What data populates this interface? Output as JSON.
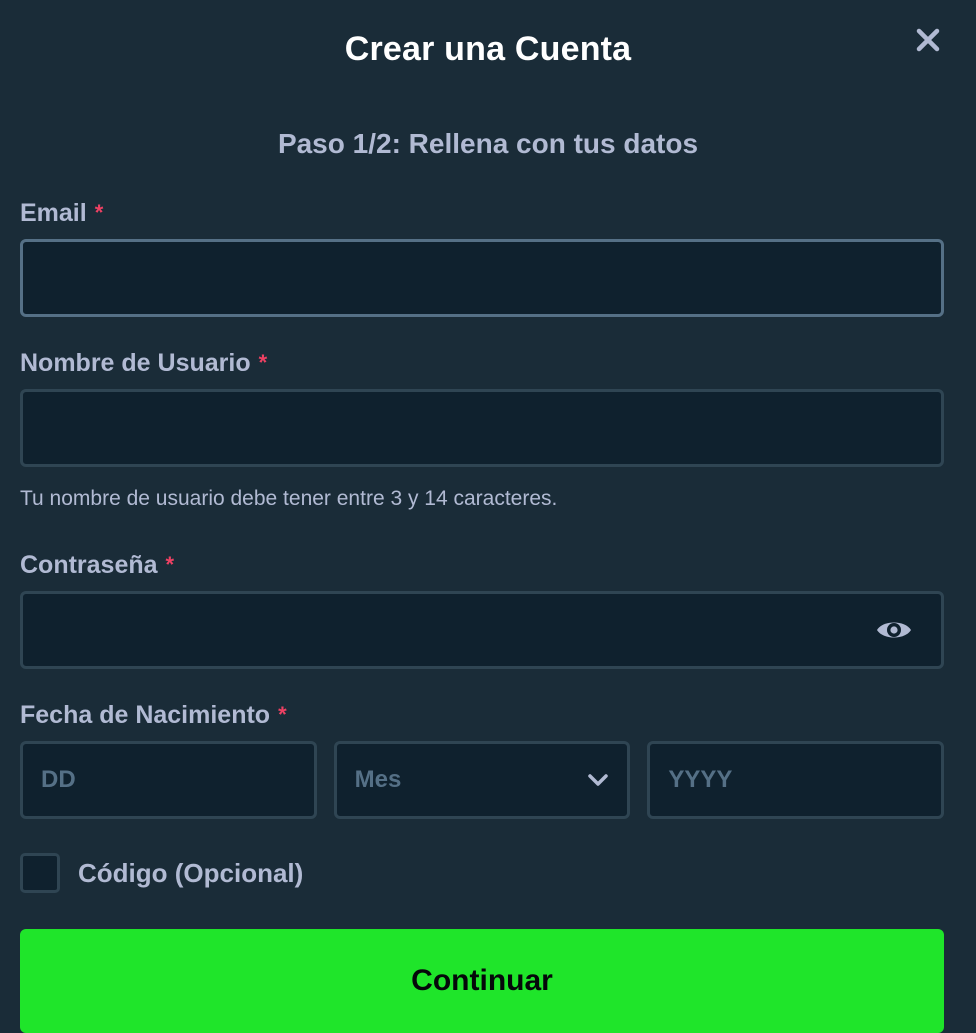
{
  "modal": {
    "title": "Crear una Cuenta",
    "step": "Paso 1/2: Rellena con tus datos"
  },
  "form": {
    "email": {
      "label": "Email",
      "required_mark": "*",
      "value": ""
    },
    "username": {
      "label": "Nombre de Usuario",
      "required_mark": "*",
      "value": "",
      "help": "Tu nombre de usuario debe tener entre 3 y 14 caracteres."
    },
    "password": {
      "label": "Contraseña",
      "required_mark": "*",
      "value": ""
    },
    "dob": {
      "label": "Fecha de Nacimiento",
      "required_mark": "*",
      "day_placeholder": "DD",
      "month_value": "Mes",
      "year_placeholder": "YYYY"
    },
    "code": {
      "label": "Código (Opcional)",
      "checked": false
    }
  },
  "actions": {
    "continue_label": "Continuar"
  },
  "icons": {
    "close": "close-icon",
    "eye": "eye-icon",
    "chevron": "chevron-down-icon"
  },
  "colors": {
    "background": "#1a2c38",
    "input_bg": "#0f212e",
    "accent_green": "#1fe52a",
    "required": "#ed4163"
  }
}
